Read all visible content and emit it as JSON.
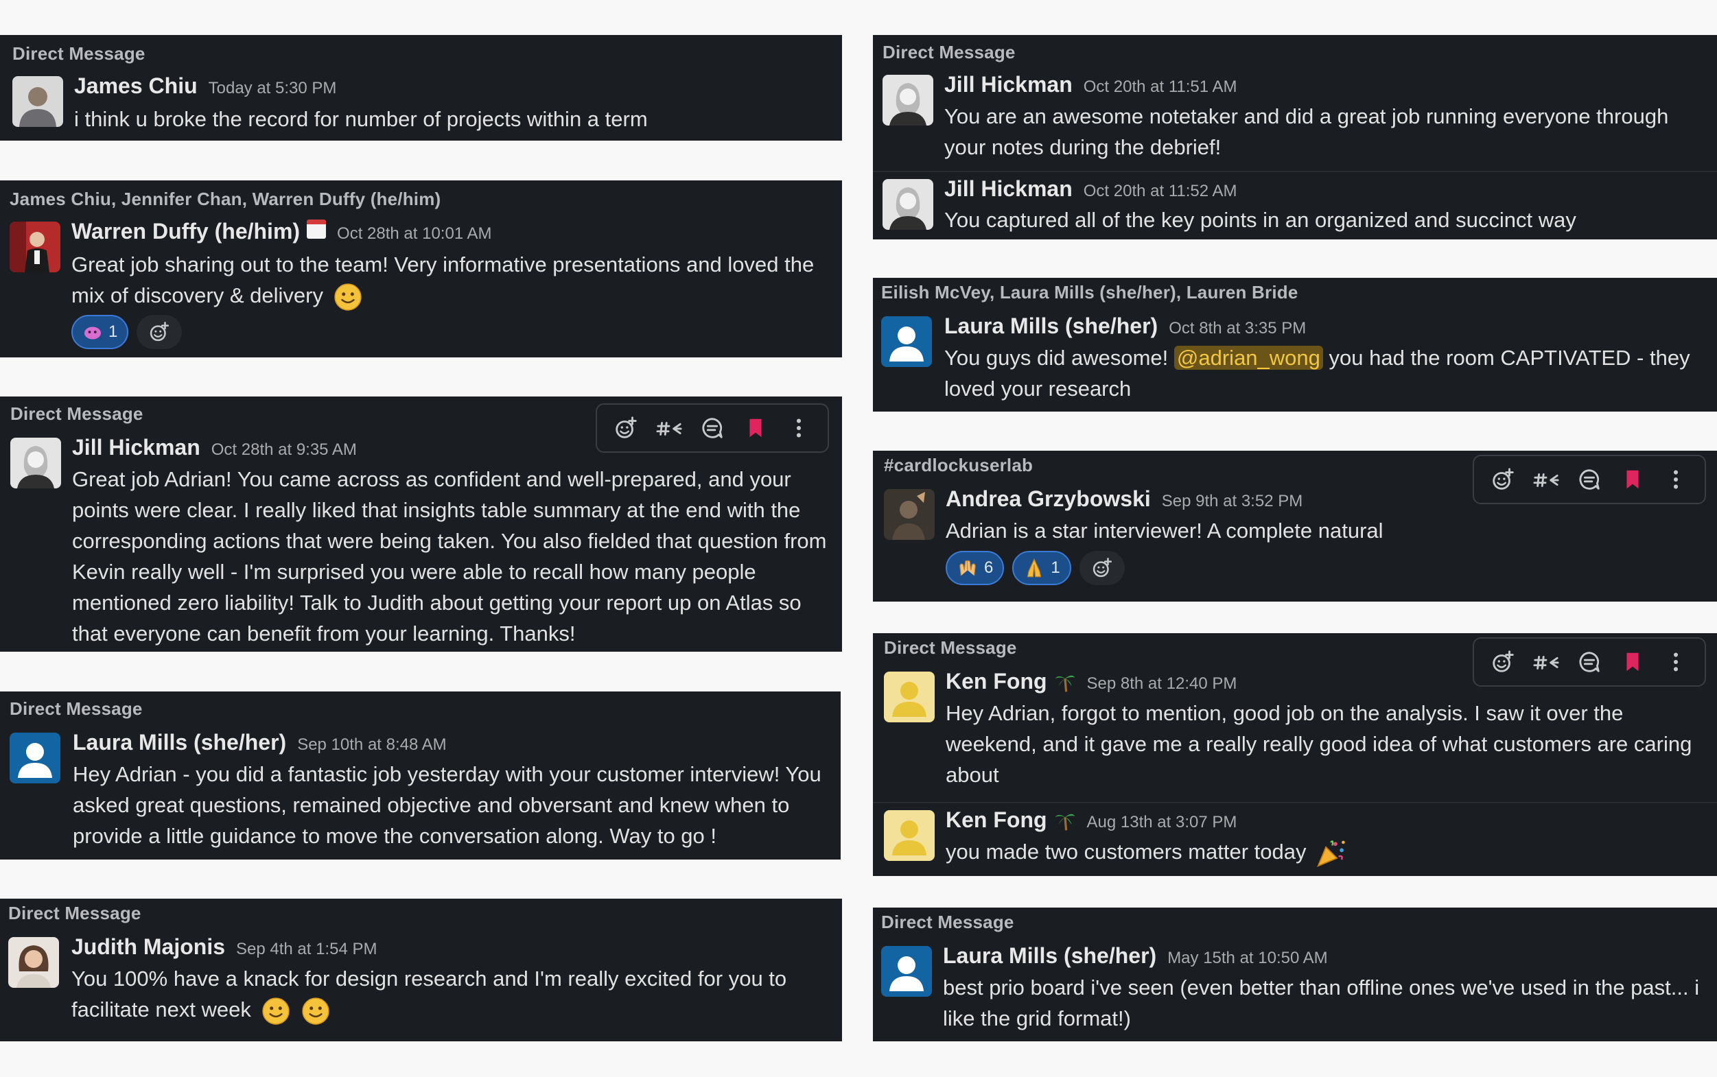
{
  "colors": {
    "card": "#1a1d21",
    "mention_bg": "#6b5417",
    "mention_fg": "#f2c744",
    "reaction_bg": "#1d4e8c",
    "bookmark": "#e0245e"
  },
  "cards": [
    {
      "context": "Direct Message",
      "messages": [
        {
          "name": "James Chiu",
          "time": "Today at 5:30 PM",
          "text": "i think u broke the record for number of projects within a term"
        }
      ]
    },
    {
      "context": "James Chiu, Jennifer Chan, Warren Duffy (he/him)",
      "messages": [
        {
          "name": "Warren Duffy (he/him)",
          "time": "Oct 28th at 10:01 AM",
          "text": "Great job sharing out to the team! Very informative presentations and loved the mix of discovery & delivery",
          "reactions": [
            {
              "icon": "blob-emoji",
              "count": "1"
            }
          ]
        }
      ]
    },
    {
      "context": "Direct Message",
      "messages": [
        {
          "name": "Jill Hickman",
          "time": "Oct 28th at 9:35 AM",
          "text": "Great job Adrian!  You came across as confident and well-prepared, and your points were clear.  I really liked that insights table summary at the end with the corresponding actions that were being taken.  You also fielded that question from Kevin really well - I'm surprised you were able to recall how many people mentioned zero liability!  Talk to Judith about getting your report up on Atlas so that everyone can benefit from your learning.  Thanks!"
        }
      ]
    },
    {
      "context": "Direct Message",
      "messages": [
        {
          "name": "Laura Mills (she/her)",
          "time": "Sep 10th at 8:48 AM",
          "text": "Hey Adrian - you did a fantastic job yesterday with your customer interview! You asked great questions, remained objective and obversant and knew when to provide a little guidance to move the conversation along. Way to go !"
        }
      ]
    },
    {
      "context": "Direct Message",
      "messages": [
        {
          "name": "Judith Majonis",
          "time": "Sep 4th at 1:54 PM",
          "text": "You 100% have a knack for design research and I'm really excited for you to facilitate next week"
        }
      ]
    },
    {
      "context": "Direct Message",
      "messages": [
        {
          "name": "Jill Hickman",
          "time": "Oct 20th at 11:51 AM",
          "text": "You are an awesome notetaker and did a great job running everyone through your notes during the debrief!"
        },
        {
          "name": "Jill Hickman",
          "time": "Oct 20th at 11:52 AM",
          "text": "You captured all of the key points in an organized and succinct way"
        }
      ]
    },
    {
      "context": "Eilish McVey, Laura Mills (she/her), Lauren Bride",
      "messages": [
        {
          "name": "Laura Mills (she/her)",
          "time": "Oct 8th at 3:35 PM",
          "text_before": "You guys did awesome! ",
          "mention": "@adrian_wong",
          "text_after": " you had the room CAPTIVATED - they loved your research"
        }
      ]
    },
    {
      "context": "#cardlockuserlab",
      "messages": [
        {
          "name": "Andrea Grzybowski",
          "time": "Sep 9th at 3:52 PM",
          "text": "Adrian is a star interviewer! A complete natural",
          "reactions": [
            {
              "icon": "raised-hands-emoji",
              "count": "6"
            },
            {
              "icon": "folded-hands-emoji",
              "count": "1"
            }
          ]
        }
      ]
    },
    {
      "context": "Direct Message",
      "messages": [
        {
          "name": "Ken Fong",
          "time": "Sep 8th at 12:40 PM",
          "text": "Hey Adrian, forgot to mention, good job on the analysis. I saw it over the weekend, and it gave me a really really good idea of what customers are caring about"
        },
        {
          "name": "Ken Fong",
          "time": "Aug 13th at 3:07 PM",
          "text": "you made two customers matter today"
        }
      ]
    },
    {
      "context": "Direct Message",
      "messages": [
        {
          "name": "Laura Mills (she/her)",
          "time": "May 15th at 10:50 AM",
          "text": "best prio board i've seen (even better than offline ones we've used in the past... i like the grid format!)"
        }
      ]
    }
  ]
}
